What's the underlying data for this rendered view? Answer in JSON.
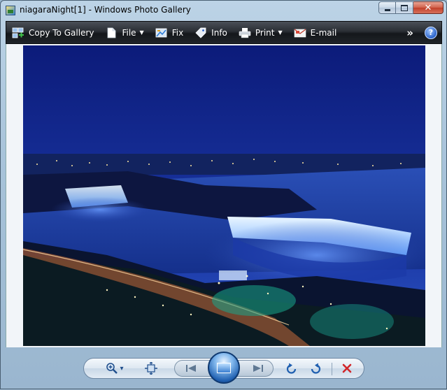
{
  "window": {
    "title": "niagaraNight[1] - Windows Photo Gallery"
  },
  "toolbar": {
    "items": [
      {
        "label": "Copy To Gallery",
        "icon": "copy-to-gallery-icon",
        "has_menu": false
      },
      {
        "label": "File",
        "icon": "file-icon",
        "has_menu": true
      },
      {
        "label": "Fix",
        "icon": "fix-icon",
        "has_menu": false
      },
      {
        "label": "Info",
        "icon": "info-tag-icon",
        "has_menu": false
      },
      {
        "label": "Print",
        "icon": "printer-icon",
        "has_menu": true
      },
      {
        "label": "E-mail",
        "icon": "email-icon",
        "has_menu": false
      }
    ],
    "overflow_glyph": "»",
    "help_glyph": "?",
    "menu_caret": "▼"
  },
  "controls": {
    "zoom_caret": "▾"
  },
  "colors": {
    "toolbar_bg": "#1f2328",
    "accent_blue": "#1f5fb0",
    "delete_red": "#d1262a"
  }
}
